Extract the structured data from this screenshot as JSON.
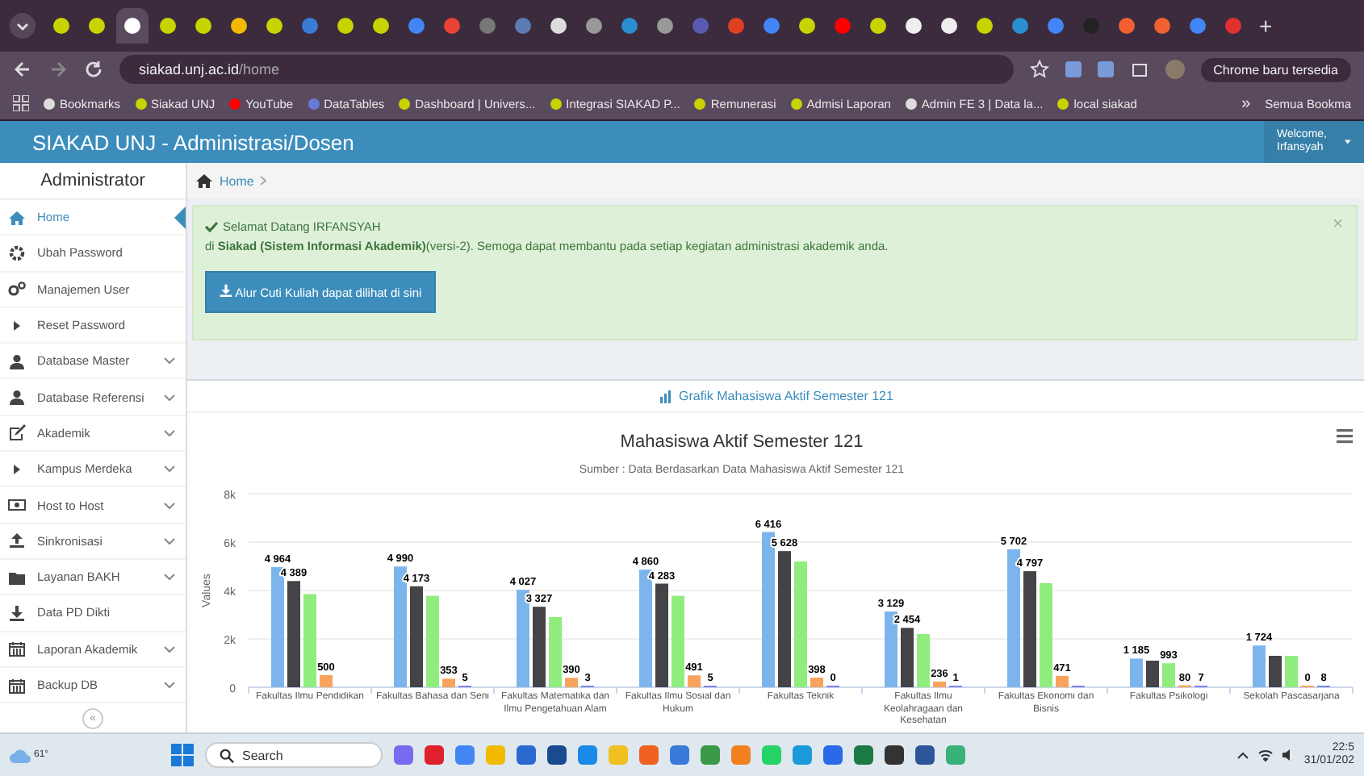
{
  "browser": {
    "tabs": [
      {
        "color": "#c8d400",
        "selected": false
      },
      {
        "color": "#c8d400",
        "selected": false
      },
      {
        "color": "#ffffff",
        "selected": true
      },
      {
        "color": "#c8d400",
        "selected": false
      },
      {
        "color": "#c8d400",
        "selected": false
      },
      {
        "color": "#f2b900",
        "selected": false
      },
      {
        "color": "#c8d400",
        "selected": false
      },
      {
        "color": "#3a7bd5",
        "selected": false
      },
      {
        "color": "#c8d400",
        "selected": false
      },
      {
        "color": "#c8d400",
        "selected": false
      },
      {
        "color": "#4285f4",
        "selected": false
      },
      {
        "color": "#ea4335",
        "selected": false
      },
      {
        "color": "#777777",
        "selected": false
      },
      {
        "color": "#5b7bb5",
        "selected": false
      },
      {
        "color": "#dddddd",
        "selected": false
      },
      {
        "color": "#999999",
        "selected": false
      },
      {
        "color": "#2a8fd0",
        "selected": false
      },
      {
        "color": "#999999",
        "selected": false
      },
      {
        "color": "#5a5ab0",
        "selected": false
      },
      {
        "color": "#e04020",
        "selected": false
      },
      {
        "color": "#4285f4",
        "selected": false
      },
      {
        "color": "#c8d400",
        "selected": false
      },
      {
        "color": "#ff0000",
        "selected": false
      },
      {
        "color": "#c8d400",
        "selected": false
      },
      {
        "color": "#eeeeee",
        "selected": false
      },
      {
        "color": "#eeeeee",
        "selected": false
      },
      {
        "color": "#c8d400",
        "selected": false
      },
      {
        "color": "#2a8fd0",
        "selected": false
      },
      {
        "color": "#4285f4",
        "selected": false
      },
      {
        "color": "#222222",
        "selected": false
      },
      {
        "color": "#f06030",
        "selected": false
      },
      {
        "color": "#f06030",
        "selected": false
      },
      {
        "color": "#4285f4",
        "selected": false
      },
      {
        "color": "#e03030",
        "selected": false
      }
    ],
    "new_tab": "+",
    "address": {
      "host": "siakad.unj.ac.id",
      "path": "/home"
    },
    "update_notice": "Chrome baru tersedia",
    "bookmarks": [
      {
        "label": "Bookmarks",
        "color": "#dddddd"
      },
      {
        "label": "Siakad UNJ",
        "color": "#c8d400"
      },
      {
        "label": "YouTube",
        "color": "#ff0000"
      },
      {
        "label": "DataTables",
        "color": "#6a7ad8"
      },
      {
        "label": "Dashboard | Univers...",
        "color": "#c8d400"
      },
      {
        "label": "Integrasi SIAKAD P...",
        "color": "#c8d400"
      },
      {
        "label": "Remunerasi",
        "color": "#c8d400"
      },
      {
        "label": "Admisi Laporan",
        "color": "#c8d400"
      },
      {
        "label": "Admin FE 3 | Data la...",
        "color": "#dddddd"
      },
      {
        "label": "local siakad",
        "color": "#c8d400"
      }
    ],
    "more": "»",
    "all_bookmarks": "Semua Bookma"
  },
  "header": {
    "title": "SIAKAD UNJ - Administrasi/Dosen",
    "user": "Welcome, Irfansyah"
  },
  "sidebar": {
    "title": "Administrator",
    "items": [
      {
        "label": "Home",
        "kind": "home",
        "selected": true,
        "expandable": false
      },
      {
        "label": "Ubah Password",
        "kind": "gear",
        "selected": false,
        "expandable": false
      },
      {
        "label": "Manajemen User",
        "kind": "gears",
        "selected": false,
        "expandable": false
      },
      {
        "label": "Reset Password",
        "kind": "caret",
        "selected": false,
        "expandable": false
      },
      {
        "label": "Database Master",
        "kind": "user",
        "selected": false,
        "expandable": true
      },
      {
        "label": "Database Referensi",
        "kind": "user",
        "selected": false,
        "expandable": true
      },
      {
        "label": "Akademik",
        "kind": "edit",
        "selected": false,
        "expandable": true
      },
      {
        "label": "Kampus Merdeka",
        "kind": "caret",
        "selected": false,
        "expandable": true
      },
      {
        "label": "Host to Host",
        "kind": "money",
        "selected": false,
        "expandable": true
      },
      {
        "label": "Sinkronisasi",
        "kind": "upload",
        "selected": false,
        "expandable": true
      },
      {
        "label": "Layanan BAKH",
        "kind": "folder",
        "selected": false,
        "expandable": true
      },
      {
        "label": "Data PD Dikti",
        "kind": "download",
        "selected": false,
        "expandable": false
      },
      {
        "label": "Laporan Akademik",
        "kind": "calendar",
        "selected": false,
        "expandable": true
      },
      {
        "label": "Backup DB",
        "kind": "calendar",
        "selected": false,
        "expandable": true
      }
    ],
    "collapse": "«"
  },
  "breadcrumb": "Home",
  "alert": {
    "greeting": "Selamat Datang IRFANSYAH",
    "message": "di **Siakad (Sistem Informasi Akademik)**(versi-2). Semoga dapat membantu pada setiap kegiatan administrasi akademik anda.",
    "close": "×",
    "button": "Alur Cuti Kuliah dapat dilihat di sini"
  },
  "panel": {
    "heading": "Grafik Mahasiswa Aktif Semester 121",
    "chart_subtitle": "Sumber : Data Berdasarkan Data Mahasiswa Aktif Semester 121",
    "chart_data": {
      "type": "bar",
      "title": "Mahasiswa Aktif Semester 121",
      "grid": true,
      "ylabel": "Values",
      "ylim": [
        0,
        8000
      ],
      "yticks": [
        {
          "value": 0,
          "label": "0"
        },
        {
          "value": 2000,
          "label": "2k"
        },
        {
          "value": 4000,
          "label": "4k"
        },
        {
          "value": 6000,
          "label": "6k"
        },
        {
          "value": 8000,
          "label": "8k"
        }
      ],
      "categories": [
        "Fakultas Ilmu Pendidikan",
        "Fakultas Bahasa dan Seni",
        "Fakultas Matematika dan Ilmu Pengetahuan Alam",
        "Fakultas Ilmu Sosial dan Hukum",
        "Fakultas Teknik",
        "Fakultas Ilmu Keolahragaan dan Kesehatan",
        "Fakultas Ekonomi dan Bisnis",
        "Fakultas Psikologi",
        "Sekolah Pascasarjana"
      ],
      "series": [
        {
          "color": "#7cb5ec",
          "values": [
            4964,
            4990,
            4027,
            4860,
            6416,
            3129,
            5702,
            1185,
            1724
          ],
          "value_labels": [
            "4 964",
            "4 990",
            "4 027",
            "4 860",
            "6 416",
            "3 129",
            "5 702",
            "1 185",
            "1 724"
          ]
        },
        {
          "color": "#434348",
          "values": [
            4389,
            4173,
            3327,
            4283,
            5628,
            2454,
            4797,
            1100,
            1300
          ],
          "value_labels": [
            "4 389",
            "4 173",
            "3 327",
            "4 283",
            "5 628",
            "2 454",
            "4 797",
            null,
            null
          ]
        },
        {
          "color": "#90ed7d",
          "values": [
            3850,
            3780,
            2900,
            3780,
            5200,
            2200,
            4300,
            993,
            1300
          ],
          "value_labels": [
            null,
            null,
            null,
            null,
            null,
            null,
            null,
            "993",
            null
          ]
        },
        {
          "color": "#f7a35c",
          "values": [
            500,
            353,
            390,
            491,
            398,
            236,
            471,
            80,
            0
          ],
          "value_labels": [
            "500",
            "353",
            "390",
            "491",
            "398",
            "236",
            "471",
            "80",
            "0"
          ]
        },
        {
          "color": "#8085e9",
          "values": [
            null,
            5,
            3,
            5,
            0,
            1,
            20,
            7,
            8
          ],
          "value_labels": [
            null,
            "5",
            "3",
            "5",
            "0",
            "1",
            null,
            "7",
            "8"
          ]
        }
      ]
    }
  },
  "taskbar": {
    "weather": "61°",
    "search": "Search",
    "apps": [
      {
        "color": "#7a6af0"
      },
      {
        "color": "#e0202a"
      },
      {
        "color": "#4285f4"
      },
      {
        "color": "#f2b900"
      },
      {
        "color": "#2a6ad0"
      },
      {
        "color": "#1a4a90"
      },
      {
        "color": "#1a8ae8"
      },
      {
        "color": "#f0c020"
      },
      {
        "color": "#f06020"
      },
      {
        "color": "#3a7ad8"
      },
      {
        "color": "#3a9a4a"
      },
      {
        "color": "#f08020"
      },
      {
        "color": "#25d366"
      },
      {
        "color": "#1a9ad8"
      },
      {
        "color": "#2a6ae8"
      },
      {
        "color": "#1d7a44"
      },
      {
        "color": "#333333"
      },
      {
        "color": "#2b579a"
      },
      {
        "color": "#3ab07a"
      }
    ],
    "time": "22:5",
    "date": "31/01/202"
  }
}
